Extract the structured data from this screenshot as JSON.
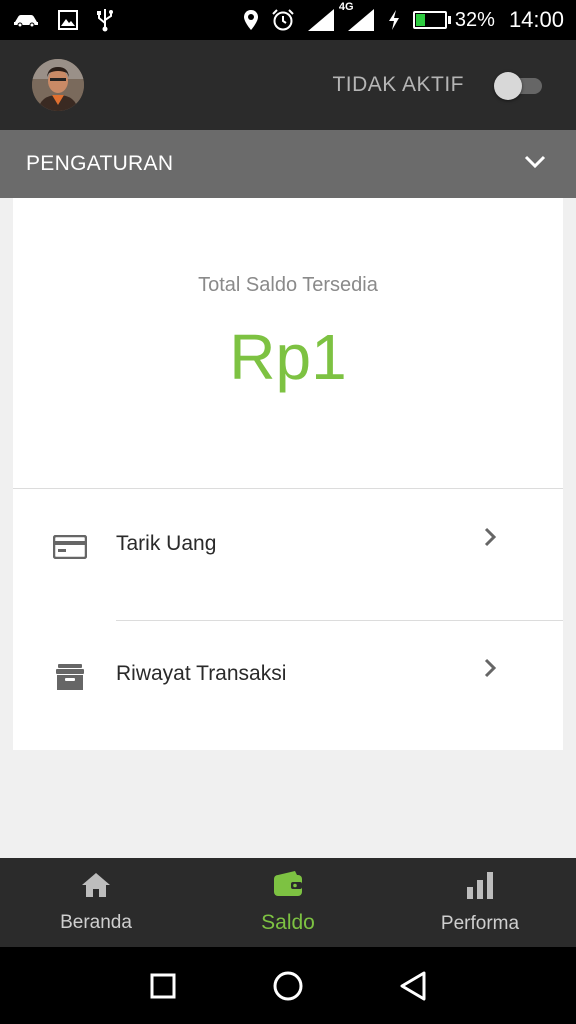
{
  "status_bar": {
    "battery_percent_text": "32%",
    "battery_level": 0.32,
    "network_label": "4G",
    "time": "14:00",
    "icons": [
      "car-icon",
      "image-icon",
      "usb-icon",
      "location-icon",
      "alarm-icon",
      "signal-icon",
      "signal-4g-icon",
      "charging-icon",
      "battery-icon"
    ]
  },
  "header": {
    "status_label": "TIDAK AKTIF",
    "toggle_on": false
  },
  "settings": {
    "title": "PENGATURAN",
    "expanded": false
  },
  "balance": {
    "label": "Total Saldo Tersedia",
    "value": "Rp1",
    "color": "#7dc242"
  },
  "menu": [
    {
      "label": "Tarik Uang",
      "icon": "card-icon"
    },
    {
      "label": "Riwayat Transaksi",
      "icon": "archive-icon"
    }
  ],
  "bottom_nav": {
    "active_index": 1,
    "active_color": "#7dc242",
    "items": [
      {
        "label": "Beranda",
        "icon": "home-icon"
      },
      {
        "label": "Saldo",
        "icon": "wallet-icon"
      },
      {
        "label": "Performa",
        "icon": "bar-chart-icon"
      }
    ]
  },
  "system_nav": [
    "recent-apps-icon",
    "home-circle-icon",
    "back-icon"
  ]
}
